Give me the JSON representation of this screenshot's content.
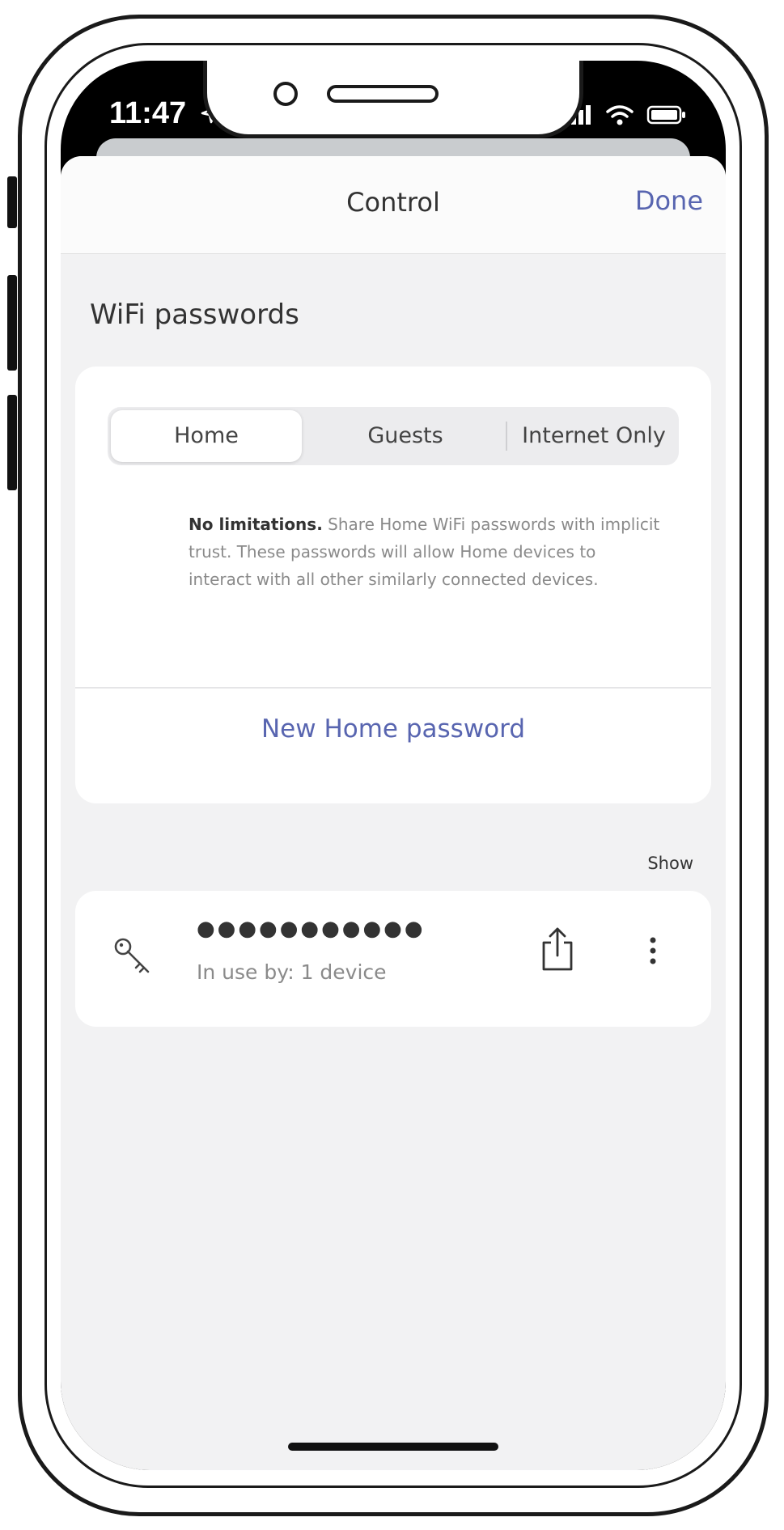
{
  "status_bar": {
    "time": "11:47"
  },
  "nav": {
    "title": "Control",
    "done_label": "Done"
  },
  "section": {
    "title": "WiFi passwords"
  },
  "segmented": {
    "options": [
      "Home",
      "Guests",
      "Internet Only"
    ],
    "selected": "Home"
  },
  "description": {
    "bold": "No limitations.",
    "text": " Share Home WiFi passwords with implicit trust. These passwords will allow Home devices to interact with all other similarly connected devices."
  },
  "actions": {
    "new_password": "New Home password",
    "show": "Show"
  },
  "password_item": {
    "masked": "●●●●●●●●●●●",
    "usage": "In use by: 1 device"
  },
  "colors": {
    "accent": "#5865b0",
    "sheet_bg": "#f2f2f3",
    "card_bg": "#ffffff"
  },
  "icons": [
    "location-arrow-icon",
    "signal-icon",
    "wifi-icon",
    "battery-icon",
    "key-icon",
    "share-icon",
    "more-vertical-icon"
  ]
}
